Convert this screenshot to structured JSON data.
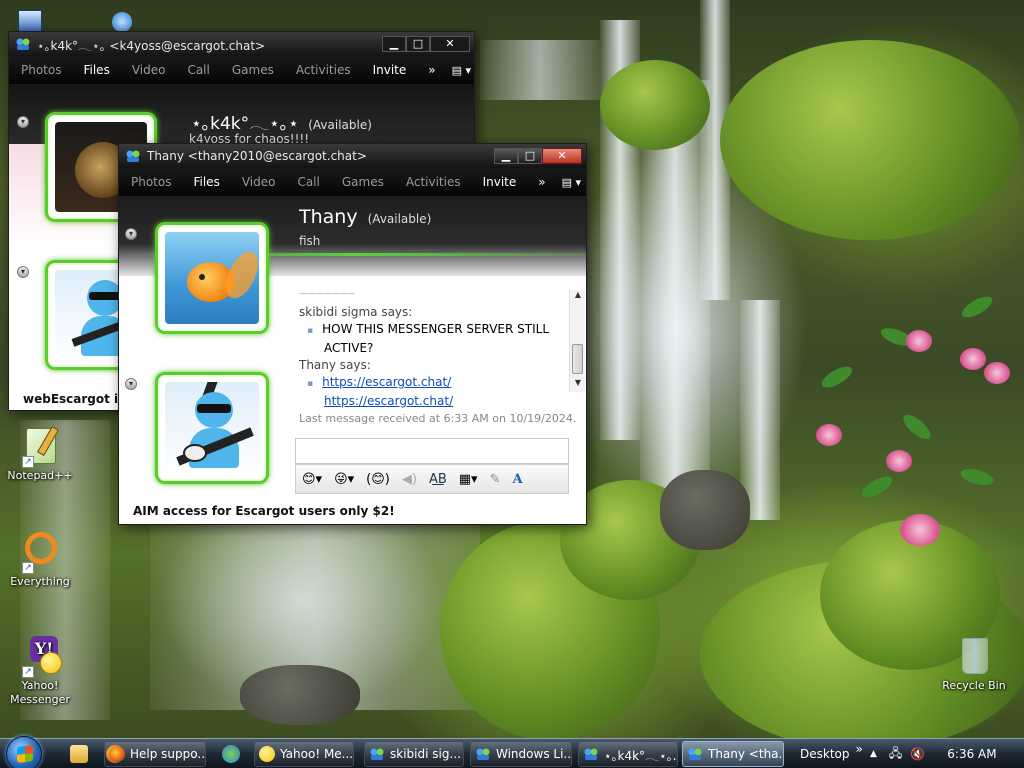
{
  "desktop": {
    "icons": [
      {
        "label": "Notepad++",
        "icon": "notepadpp-icon"
      },
      {
        "label": "Everything",
        "icon": "everything-icon"
      },
      {
        "label": "Yahoo!\nMessenger",
        "icon": "yahoo-messenger-icon"
      },
      {
        "label": "Recycle Bin",
        "icon": "recycle-bin-icon"
      }
    ]
  },
  "window_back": {
    "title": "⋆｡k4k°⁠𓂃⋆｡ <k4yoss@escargot.chat>",
    "menu": [
      "Photos",
      "Files",
      "Video",
      "Call",
      "Games",
      "Activities",
      "Invite"
    ],
    "active_menu": "Files",
    "more": "»",
    "contact_name": "⋆｡k4k°⁠𓂃⋆｡⋆",
    "contact_status": "(Available)",
    "personal_message": "k4yoss for chaos!!!!",
    "footer": "webEscargot is no"
  },
  "window_front": {
    "title": "Thany <thany2010@escargot.chat>",
    "menu": [
      "Photos",
      "Files",
      "Video",
      "Call",
      "Games",
      "Activities",
      "Invite"
    ],
    "active_menu": "Files",
    "more": "»",
    "contact_name": "Thany",
    "contact_status": "(Available)",
    "personal_message": "fish",
    "conversation": {
      "divider": "———————",
      "msg1_sender": "skibidi sigma says:",
      "msg1_lines": [
        "HOW THIS MESSENGER SERVER STILL",
        "ACTIVE?"
      ],
      "msg2_sender": "Thany says:",
      "msg2_links": [
        "https://escargot.chat/",
        "https://escargot.chat/"
      ],
      "last_received": "Last message received at 6:33 AM on 10/19/2024."
    },
    "ad_text": "AIM access for Escargot users only $2!"
  },
  "taskbar": {
    "items": [
      {
        "label": "Help suppo...",
        "icon": "firefox-icon"
      },
      {
        "label": "Yahoo! Me...",
        "icon": "yahoo-messenger-icon"
      },
      {
        "label": "skibidi sig...",
        "icon": "wlm-icon"
      },
      {
        "label": "Windows Li...",
        "icon": "wlm-icon"
      },
      {
        "label": "⋆｡k4k°⁠𓂃⋆｡...",
        "icon": "wlm-icon"
      },
      {
        "label": "Thany <tha...",
        "icon": "wlm-icon"
      }
    ],
    "desktop_label": "Desktop",
    "chevron": "»",
    "clock": "6:36 AM"
  },
  "colors": {
    "accent_green": "#5ccb2c",
    "link": "#0b4dbd",
    "titlebar": "#141414"
  }
}
